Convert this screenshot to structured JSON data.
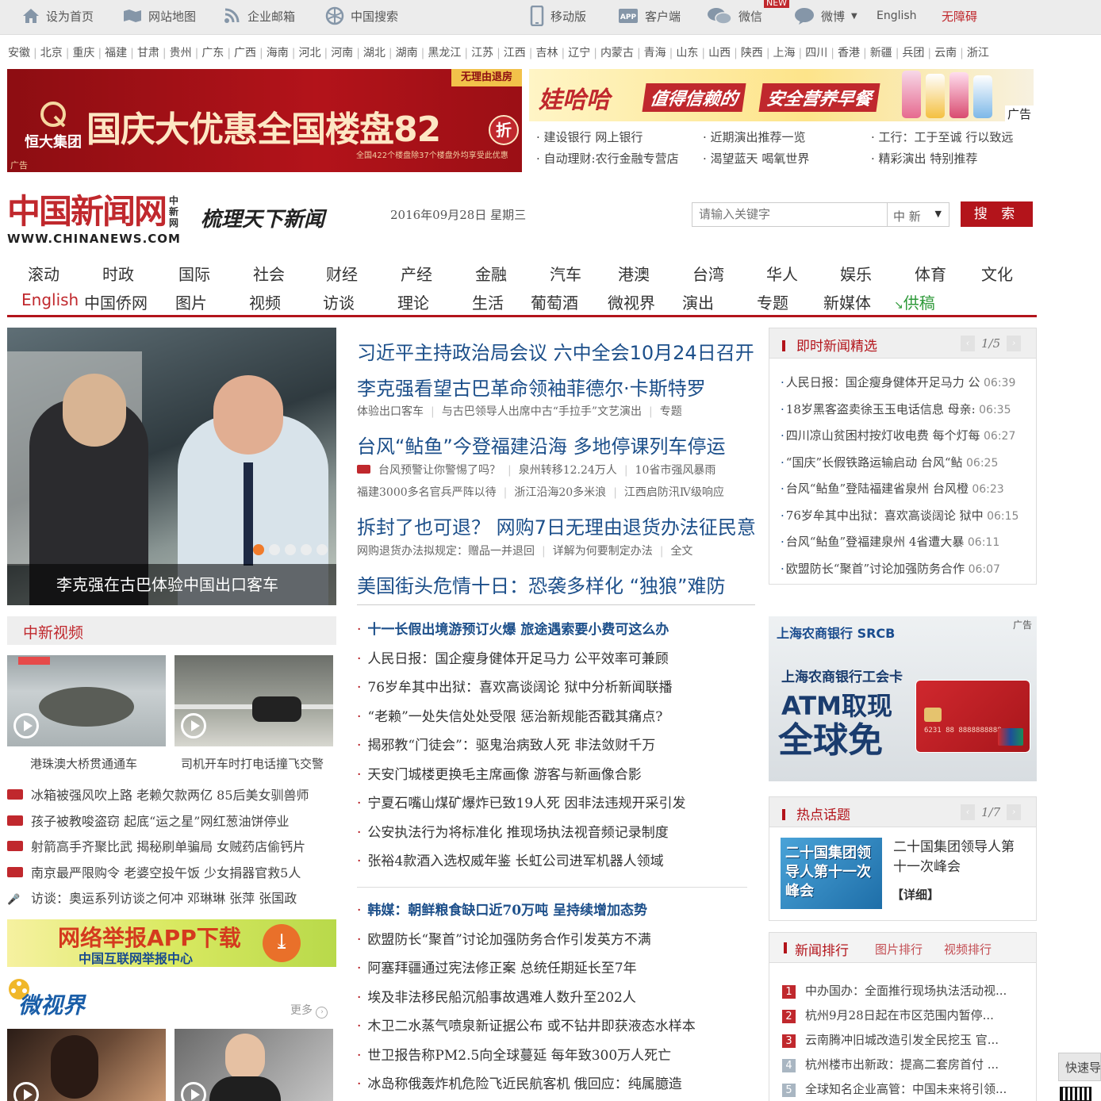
{
  "topbar": {
    "set_home": "设为首页",
    "sitemap": "网站地图",
    "mail": "企业邮箱",
    "search": "中国搜索",
    "mobile": "移动版",
    "client": "客户端",
    "wechat": "微信",
    "new_badge": "NEW",
    "weibo": "微博",
    "english": "English",
    "accessible": "无障碍"
  },
  "regions": [
    "安徽",
    "北京",
    "重庆",
    "福建",
    "甘肃",
    "贵州",
    "广东",
    "广西",
    "海南",
    "河北",
    "河南",
    "湖北",
    "湖南",
    "黑龙江",
    "江苏",
    "江西",
    "吉林",
    "辽宁",
    "内蒙古",
    "青海",
    "山东",
    "山西",
    "陕西",
    "上海",
    "四川",
    "香港",
    "新疆",
    "兵团",
    "云南",
    "浙江"
  ],
  "ads": {
    "left_badge": "无理由退房",
    "left_brand": "恒大集团",
    "left_title": "国庆大优惠全国楼盘82",
    "left_zhe": "折",
    "left_sub": "全国422个楼盘除37个楼盘外均享受此优惠",
    "ad_label": "广告",
    "right_brand": "娃哈哈",
    "right_slogan1": "值得信赖的",
    "right_slogan2": "安全营养早餐",
    "links": [
      "建设银行 网上银行",
      "近期演出推荐一览",
      "工行：工于至诚 行以致远",
      "自动理财:农行金融专营店",
      "渴望蓝天 喝氧世界",
      "精彩演出 特别推荐"
    ]
  },
  "header": {
    "logo_cn": "中国新闻网",
    "logo_side": "中新网",
    "logo_url": "WWW.CHINANEWS.COM",
    "slogan": "梳理天下新闻",
    "date": "2016年09月28日  星期三",
    "search_placeholder": "请输入关键字",
    "search_scope": "中 新",
    "search_button": "搜 索"
  },
  "nav": {
    "row1": [
      "滚动",
      "时政",
      "国际",
      "社会",
      "财经",
      "产经",
      "金融",
      "汽车",
      "港澳",
      "台湾",
      "华人",
      "娱乐",
      "体育",
      "文化"
    ],
    "row2": [
      "English",
      "中国侨网",
      "图片",
      "视频",
      "访谈",
      "理论",
      "生活",
      "葡萄酒",
      "微视界",
      "演出",
      "专题",
      "新媒体",
      "供稿"
    ]
  },
  "hero": {
    "caption": "李克强在古巴体验中国出口客车"
  },
  "headlines": {
    "h1": "习近平主持政治局会议 六中全会10月24日召开",
    "h2": "李克强看望古巴革命领袖菲德尔·卡斯特罗",
    "h2_sub": [
      "体验出口客车",
      "与古巴领导人出席中古“手拉手”文艺演出",
      "专题"
    ],
    "h3": "台风“鲇鱼”今登福建沿海 多地停课列车停运",
    "h3_sub1": [
      "台风预警让你警惕了吗？",
      "泉州转移12.24万人",
      "10省市强风暴雨"
    ],
    "h3_sub2": [
      "福建3000多名官兵严阵以待",
      "浙江沿海20多米浪",
      "江西启防汛Ⅳ级响应"
    ],
    "h4": "拆封了也可退？ 网购7日无理由退货办法征民意",
    "h4_sub": [
      "网购退货办法拟规定：赠品一并退回",
      "详解为何要制定办法",
      "全文"
    ],
    "h5": "美国街头危情十日：恐袭多样化 “独狼”难防"
  },
  "news_list_1": [
    "十一长假出境游预订火爆 旅途遇索要小费可这么办",
    "人民日报：国企瘦身健体开足马力 公平效率可兼顾",
    "76岁牟其中出狱：喜欢高谈阔论 狱中分析新闻联播",
    "“老赖”一处失信处处受限 惩治新规能否戳其痛点?",
    "揭邪教“门徒会”：驱鬼治病致人死 非法敛财千万",
    "天安门城楼更换毛主席画像 游客与新画像合影",
    "宁夏石嘴山煤矿爆炸已致19人死 因非法违规开采引发",
    "公安执法行为将标准化 推现场执法视音频记录制度",
    "张裕4款酒入选权威年鉴 长虹公司进军机器人领域"
  ],
  "news_list_2": [
    "韩媒：朝鲜粮食缺口近70万吨 呈持续增加态势",
    "欧盟防长“聚首”讨论加强防务合作引发英方不满",
    "阿塞拜疆通过宪法修正案 总统任期延长至7年",
    "埃及非法移民船沉船事故遇难人数升至202人",
    "木卫二水蒸气喷泉新证据公布 或不钻井即获液态水样本",
    "世卫报告称PM2.5向全球蔓延 每年致300万人死亡",
    "冰岛称俄轰炸机危险飞近民航客机 俄回应：纯属臆造"
  ],
  "live_news": {
    "title": "即时新闻精选",
    "pager": "1/5",
    "items": [
      {
        "text": "人民日报：国企瘦身健体开足马力 公",
        "time": "06:39"
      },
      {
        "text": "18岁黑客盗卖徐玉玉电话信息 母亲:",
        "time": "06:35"
      },
      {
        "text": "四川凉山贫困村按灯收电费 每个灯每",
        "time": "06:27"
      },
      {
        "text": "“国庆”长假铁路运输启动 台风“鲇",
        "time": "06:25"
      },
      {
        "text": "台风“鲇鱼”登陆福建省泉州 台风橙",
        "time": "06:23"
      },
      {
        "text": "76岁牟其中出狱：喜欢高谈阔论 狱中",
        "time": "06:15"
      },
      {
        "text": "台风“鲇鱼”登福建泉州 4省遭大暴",
        "time": "06:11"
      },
      {
        "text": "欧盟防长“聚首”讨论加强防务合作",
        "time": "06:07"
      }
    ]
  },
  "bank_ad": {
    "label": "广告",
    "bank_name": "上海农商银行 SRCB",
    "line1": "上海农商银行工会卡",
    "line2": "ATM取现",
    "line3": "全球免",
    "card_no": "6231 88 8888888888"
  },
  "hot_topics": {
    "title": "热点话题",
    "pager": "1/7",
    "image_text": "二十国集团领导人第十一次峰会",
    "text": "二十国集团领导人第十一次峰会",
    "detail": "【详细】"
  },
  "ranking": {
    "tabs": [
      "新闻排行",
      "图片排行",
      "视频排行"
    ],
    "items": [
      {
        "num": "1",
        "text": "中办国办：全面推行现场执法活动视..."
      },
      {
        "num": "2",
        "text": "杭州9月28日起在市区范围内暂停..."
      },
      {
        "num": "3",
        "text": "云南腾冲旧城改造引发全民挖玉 官..."
      },
      {
        "num": "4",
        "text": "杭州楼市出新政：提高二套房首付 ..."
      },
      {
        "num": "5",
        "text": "全球知名企业高管：中国未来将引领..."
      }
    ],
    "colors": [
      "#c0282d",
      "#c0282d",
      "#c0282d",
      "#a9b6c2",
      "#a9b6c2"
    ]
  },
  "video": {
    "title": "中新视频",
    "thumbs": [
      "港珠澳大桥贯通通车",
      "司机开车时打电话撞飞交警"
    ],
    "list": [
      "冰箱被强风吹上路 老赖欠款两亿 85后美女驯兽师",
      "孩子被教唆盗窃 起底“运之星”网红葱油饼停业",
      "射箭高手齐聚比武 揭秘刷单骗局 女贼药店偷钙片",
      "南京最严限购令 老婆空投午饭 少女捐器官救5人",
      "访谈：奥运系列访谈之何冲 邓琳琳 张萍 张国政"
    ]
  },
  "report_ad": {
    "title": "网络举报APP下载",
    "sub": "中国互联网举报中心"
  },
  "weishijie": {
    "title": "微视界",
    "more": "更多"
  },
  "float": {
    "label": "快速导"
  }
}
